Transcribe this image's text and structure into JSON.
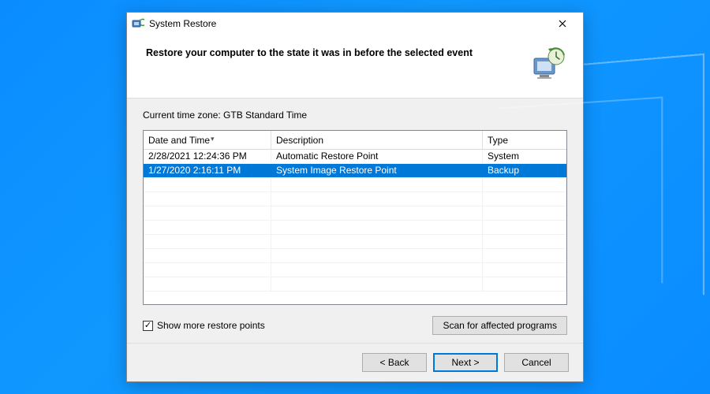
{
  "window": {
    "title": "System Restore",
    "heading": "Restore your computer to the state it was in before the selected event"
  },
  "content": {
    "timezone_label": "Current time zone: GTB Standard Time",
    "columns": {
      "date": "Date and Time",
      "description": "Description",
      "type": "Type"
    },
    "rows": [
      {
        "date": "2/28/2021 12:24:36 PM",
        "description": "Automatic Restore Point",
        "type": "System",
        "selected": false
      },
      {
        "date": "1/27/2020 2:16:11 PM",
        "description": "System Image Restore Point",
        "type": "Backup",
        "selected": true
      }
    ],
    "show_more_label": "Show more restore points",
    "show_more_checked": true,
    "scan_button": "Scan for affected programs"
  },
  "footer": {
    "back": "< Back",
    "next": "Next >",
    "cancel": "Cancel"
  }
}
